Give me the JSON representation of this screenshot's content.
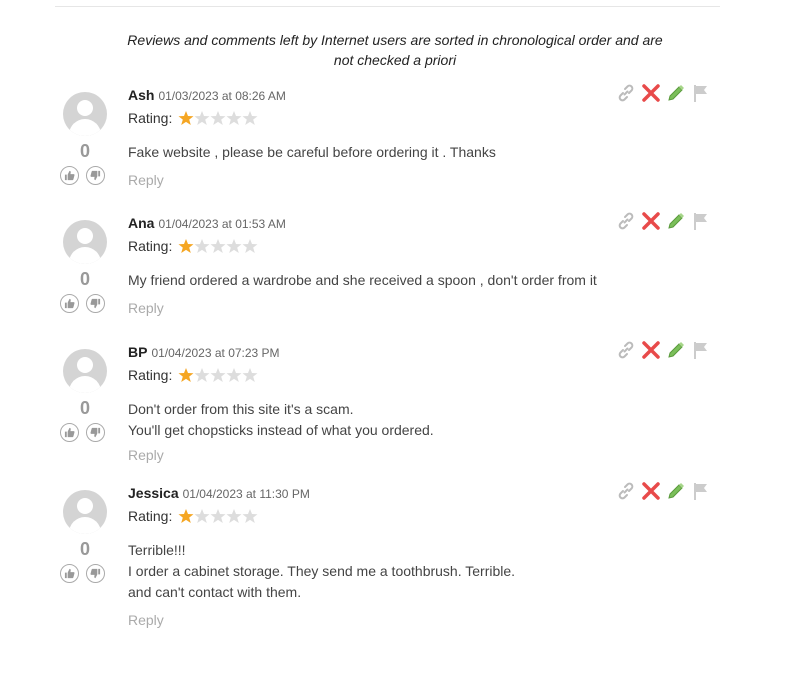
{
  "disclaimer": "Reviews and comments left by Internet users are sorted in chronological order and are not checked a priori",
  "colors": {
    "star_filled": "#f5a623",
    "star_empty": "#dddddd",
    "delete": "#e84a4a",
    "edit": "#7bbf5a",
    "link": "#bbbbbb",
    "flag": "#cccccc"
  },
  "icons": [
    "avatar-placeholder-icon",
    "thumbs-up-icon",
    "thumbs-down-icon",
    "link-icon",
    "delete-x-icon",
    "pencil-edit-icon",
    "flag-icon",
    "star-icon"
  ],
  "comments": [
    {
      "author": "Ash",
      "date": "01/03/2023 at 08:26 AM",
      "rating_label": "Rating:",
      "rating": 1,
      "rating_max": 5,
      "lines": [
        "Fake website , please be careful before ordering it . Thanks"
      ],
      "votes": "0",
      "reply_label": "Reply"
    },
    {
      "author": "Ana",
      "date": "01/04/2023 at 01:53 AM",
      "rating_label": "Rating:",
      "rating": 1,
      "rating_max": 5,
      "lines": [
        "My friend ordered a wardrobe and she received a spoon , don't order from it"
      ],
      "votes": "0",
      "reply_label": "Reply"
    },
    {
      "author": "BP",
      "date": "01/04/2023 at 07:23 PM",
      "rating_label": "Rating:",
      "rating": 1,
      "rating_max": 5,
      "lines": [
        "Don't order from this site it's a scam.",
        "You'll get chopsticks instead of what you ordered."
      ],
      "votes": "0",
      "reply_label": "Reply"
    },
    {
      "author": "Jessica",
      "date": "01/04/2023 at 11:30 PM",
      "rating_label": "Rating:",
      "rating": 1,
      "rating_max": 5,
      "lines": [
        "Terrible!!!",
        "I order a cabinet storage. They send me a toothbrush. Terrible.",
        "and can't contact with them."
      ],
      "votes": "0",
      "reply_label": "Reply"
    }
  ]
}
